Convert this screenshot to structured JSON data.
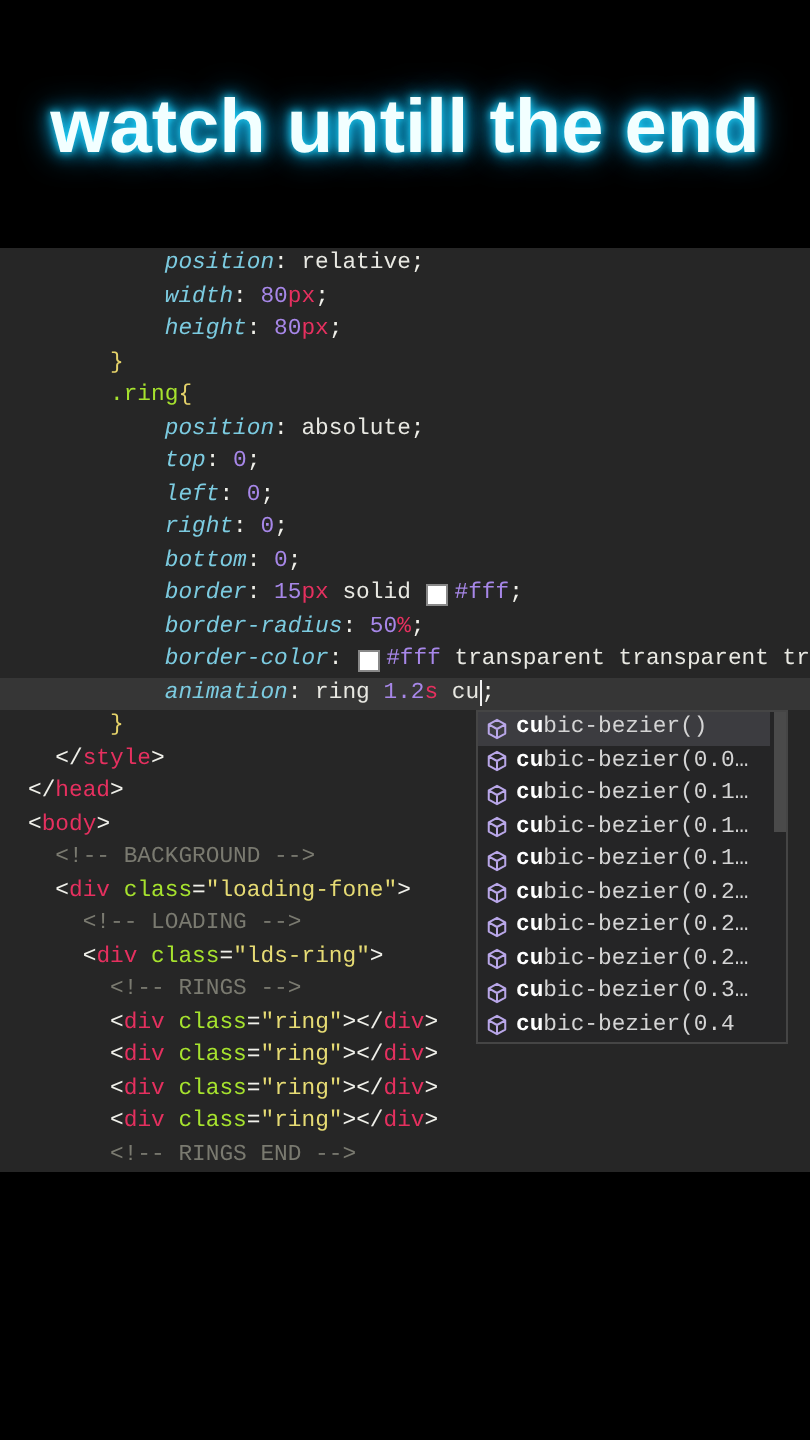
{
  "caption": "watch untill the end",
  "editor": {
    "lines": [
      {
        "current": false,
        "tokens": [
          {
            "text": "          position",
            "kind": "prop"
          },
          {
            "text": ": ",
            "kind": "punct"
          },
          {
            "text": "relative",
            "kind": "value"
          },
          {
            "text": ";",
            "kind": "punct"
          }
        ]
      },
      {
        "current": false,
        "tokens": [
          {
            "text": "          width",
            "kind": "prop"
          },
          {
            "text": ": ",
            "kind": "punct"
          },
          {
            "text": "80",
            "kind": "num"
          },
          {
            "text": "px",
            "kind": "unit"
          },
          {
            "text": ";",
            "kind": "punct"
          }
        ]
      },
      {
        "current": false,
        "tokens": [
          {
            "text": "          height",
            "kind": "prop"
          },
          {
            "text": ": ",
            "kind": "punct"
          },
          {
            "text": "80",
            "kind": "num"
          },
          {
            "text": "px",
            "kind": "unit"
          },
          {
            "text": ";",
            "kind": "punct"
          }
        ]
      },
      {
        "current": false,
        "tokens": [
          {
            "text": "      }",
            "kind": "brace"
          }
        ]
      },
      {
        "current": false,
        "tokens": [
          {
            "text": "      .ring",
            "kind": "selector"
          },
          {
            "text": "{",
            "kind": "brace"
          }
        ]
      },
      {
        "current": false,
        "tokens": [
          {
            "text": "          position",
            "kind": "prop"
          },
          {
            "text": ": ",
            "kind": "punct"
          },
          {
            "text": "absolute",
            "kind": "value"
          },
          {
            "text": ";",
            "kind": "punct"
          }
        ]
      },
      {
        "current": false,
        "tokens": [
          {
            "text": "          top",
            "kind": "prop"
          },
          {
            "text": ": ",
            "kind": "punct"
          },
          {
            "text": "0",
            "kind": "num"
          },
          {
            "text": ";",
            "kind": "punct"
          }
        ]
      },
      {
        "current": false,
        "tokens": [
          {
            "text": "          left",
            "kind": "prop"
          },
          {
            "text": ": ",
            "kind": "punct"
          },
          {
            "text": "0",
            "kind": "num"
          },
          {
            "text": ";",
            "kind": "punct"
          }
        ]
      },
      {
        "current": false,
        "tokens": [
          {
            "text": "          right",
            "kind": "prop"
          },
          {
            "text": ": ",
            "kind": "punct"
          },
          {
            "text": "0",
            "kind": "num"
          },
          {
            "text": ";",
            "kind": "punct"
          }
        ]
      },
      {
        "current": false,
        "tokens": [
          {
            "text": "          bottom",
            "kind": "prop"
          },
          {
            "text": ": ",
            "kind": "punct"
          },
          {
            "text": "0",
            "kind": "num"
          },
          {
            "text": ";",
            "kind": "punct"
          }
        ]
      },
      {
        "current": false,
        "tokens": [
          {
            "text": "          border",
            "kind": "prop"
          },
          {
            "text": ": ",
            "kind": "punct"
          },
          {
            "text": "15",
            "kind": "num"
          },
          {
            "text": "px",
            "kind": "unit"
          },
          {
            "text": " solid ",
            "kind": "value"
          },
          {
            "kind": "swatch",
            "color": "#ffffff"
          },
          {
            "text": "#fff",
            "kind": "num"
          },
          {
            "text": ";",
            "kind": "punct"
          }
        ]
      },
      {
        "current": false,
        "tokens": [
          {
            "text": "          border-radius",
            "kind": "prop"
          },
          {
            "text": ": ",
            "kind": "punct"
          },
          {
            "text": "50",
            "kind": "num"
          },
          {
            "text": "%",
            "kind": "unit"
          },
          {
            "text": ";",
            "kind": "punct"
          }
        ]
      },
      {
        "current": false,
        "tokens": [
          {
            "text": "          border-color",
            "kind": "prop"
          },
          {
            "text": ": ",
            "kind": "punct"
          },
          {
            "kind": "swatch",
            "color": "#ffffff"
          },
          {
            "text": "#fff",
            "kind": "num"
          },
          {
            "text": " transparent transparent tr",
            "kind": "value"
          }
        ]
      },
      {
        "current": true,
        "tokens": [
          {
            "text": "          animation",
            "kind": "prop"
          },
          {
            "text": ": ",
            "kind": "punct"
          },
          {
            "text": "ring ",
            "kind": "value"
          },
          {
            "text": "1.2",
            "kind": "num"
          },
          {
            "text": "s",
            "kind": "unit"
          },
          {
            "text": " cu",
            "kind": "value"
          },
          {
            "kind": "cursor"
          },
          {
            "text": ";",
            "kind": "punct"
          }
        ]
      },
      {
        "current": false,
        "tokens": [
          {
            "text": "      }",
            "kind": "brace"
          }
        ]
      },
      {
        "current": false,
        "tokens": [
          {
            "text": "  </",
            "kind": "punct"
          },
          {
            "text": "style",
            "kind": "tag"
          },
          {
            "text": ">",
            "kind": "punct"
          }
        ]
      },
      {
        "current": false,
        "tokens": [
          {
            "text": "</",
            "kind": "punct"
          },
          {
            "text": "head",
            "kind": "tag"
          },
          {
            "text": ">",
            "kind": "punct"
          }
        ]
      },
      {
        "current": false,
        "tokens": [
          {
            "text": "<",
            "kind": "punct"
          },
          {
            "text": "body",
            "kind": "tag"
          },
          {
            "text": ">",
            "kind": "punct"
          }
        ]
      },
      {
        "current": false,
        "tokens": [
          {
            "text": "  <!-- BACKGROUND -->",
            "kind": "comment"
          }
        ]
      },
      {
        "current": false,
        "tokens": [
          {
            "text": "  <",
            "kind": "punct"
          },
          {
            "text": "div",
            "kind": "tag"
          },
          {
            "text": " class",
            "kind": "attr"
          },
          {
            "text": "=",
            "kind": "punct"
          },
          {
            "text": "\"loading-fone\"",
            "kind": "string"
          },
          {
            "text": ">",
            "kind": "punct"
          }
        ]
      },
      {
        "current": false,
        "tokens": [
          {
            "text": "    <!-- LOADING -->",
            "kind": "comment"
          }
        ]
      },
      {
        "current": false,
        "tokens": [
          {
            "text": "    <",
            "kind": "punct"
          },
          {
            "text": "div",
            "kind": "tag"
          },
          {
            "text": " class",
            "kind": "attr"
          },
          {
            "text": "=",
            "kind": "punct"
          },
          {
            "text": "\"lds-ring\"",
            "kind": "string"
          },
          {
            "text": ">",
            "kind": "punct"
          }
        ]
      },
      {
        "current": false,
        "tokens": [
          {
            "text": "      <!-- RINGS -->",
            "kind": "comment"
          }
        ]
      },
      {
        "current": false,
        "tokens": [
          {
            "text": "      <",
            "kind": "punct"
          },
          {
            "text": "div",
            "kind": "tag"
          },
          {
            "text": " class",
            "kind": "attr"
          },
          {
            "text": "=",
            "kind": "punct"
          },
          {
            "text": "\"ring\"",
            "kind": "string"
          },
          {
            "text": "></",
            "kind": "punct"
          },
          {
            "text": "div",
            "kind": "tag"
          },
          {
            "text": ">",
            "kind": "punct"
          }
        ]
      },
      {
        "current": false,
        "tokens": [
          {
            "text": "      <",
            "kind": "punct"
          },
          {
            "text": "div",
            "kind": "tag"
          },
          {
            "text": " class",
            "kind": "attr"
          },
          {
            "text": "=",
            "kind": "punct"
          },
          {
            "text": "\"ring\"",
            "kind": "string"
          },
          {
            "text": "></",
            "kind": "punct"
          },
          {
            "text": "div",
            "kind": "tag"
          },
          {
            "text": ">",
            "kind": "punct"
          }
        ]
      },
      {
        "current": false,
        "tokens": [
          {
            "text": "      <",
            "kind": "punct"
          },
          {
            "text": "div",
            "kind": "tag"
          },
          {
            "text": " class",
            "kind": "attr"
          },
          {
            "text": "=",
            "kind": "punct"
          },
          {
            "text": "\"ring\"",
            "kind": "string"
          },
          {
            "text": "></",
            "kind": "punct"
          },
          {
            "text": "div",
            "kind": "tag"
          },
          {
            "text": ">",
            "kind": "punct"
          }
        ]
      },
      {
        "current": false,
        "tokens": [
          {
            "text": "      <",
            "kind": "punct"
          },
          {
            "text": "div",
            "kind": "tag"
          },
          {
            "text": " class",
            "kind": "attr"
          },
          {
            "text": "=",
            "kind": "punct"
          },
          {
            "text": "\"ring\"",
            "kind": "string"
          },
          {
            "text": "></",
            "kind": "punct"
          },
          {
            "text": "div",
            "kind": "tag"
          },
          {
            "text": ">",
            "kind": "punct"
          }
        ]
      },
      {
        "current": false,
        "tokens": [
          {
            "text": "      <!-- RINGS END -->",
            "kind": "comment"
          }
        ]
      }
    ],
    "autocomplete": {
      "items": [
        {
          "text": "**cu**bic-bezier()",
          "selected": true
        },
        {
          "text": "**cu**bic-bezier(0.0…",
          "selected": false
        },
        {
          "text": "**cu**bic-bezier(0.1…",
          "selected": false
        },
        {
          "text": "**cu**bic-bezier(0.1…",
          "selected": false
        },
        {
          "text": "**cu**bic-bezier(0.1…",
          "selected": false
        },
        {
          "text": "**cu**bic-bezier(0.2…",
          "selected": false
        },
        {
          "text": "**cu**bic-bezier(0.2…",
          "selected": false
        },
        {
          "text": "**cu**bic-bezier(0.2…",
          "selected": false
        },
        {
          "text": "**cu**bic-bezier(0.3…",
          "selected": false
        },
        {
          "text": "**cu**bic-bezier(0.4",
          "selected": false
        }
      ]
    }
  }
}
